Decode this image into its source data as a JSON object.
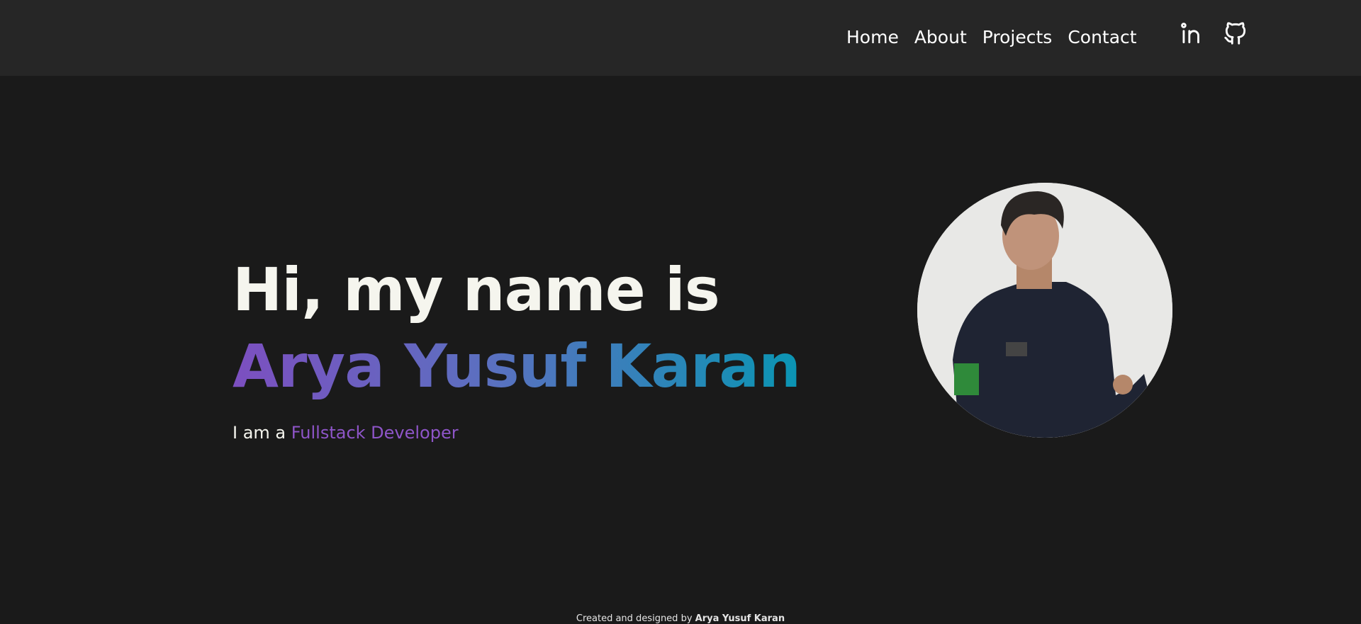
{
  "nav": {
    "items": [
      {
        "label": "Home"
      },
      {
        "label": "About"
      },
      {
        "label": "Projects"
      },
      {
        "label": "Contact"
      }
    ],
    "social": [
      {
        "icon": "linkedin-icon"
      },
      {
        "icon": "github-icon"
      }
    ]
  },
  "hero": {
    "greeting": "Hi, my name is",
    "name": "Arya Yusuf Karan",
    "intro": "I am a",
    "role": "Fullstack Developer"
  },
  "footer": {
    "text": "Created and designed by",
    "author": "Arya Yusuf Karan"
  },
  "colors": {
    "gradient_start": "#7c4fc0",
    "gradient_end": "#0a95b3",
    "role": "#8e55c8",
    "header_bg": "#262626",
    "page_bg": "#1a1a1a"
  }
}
